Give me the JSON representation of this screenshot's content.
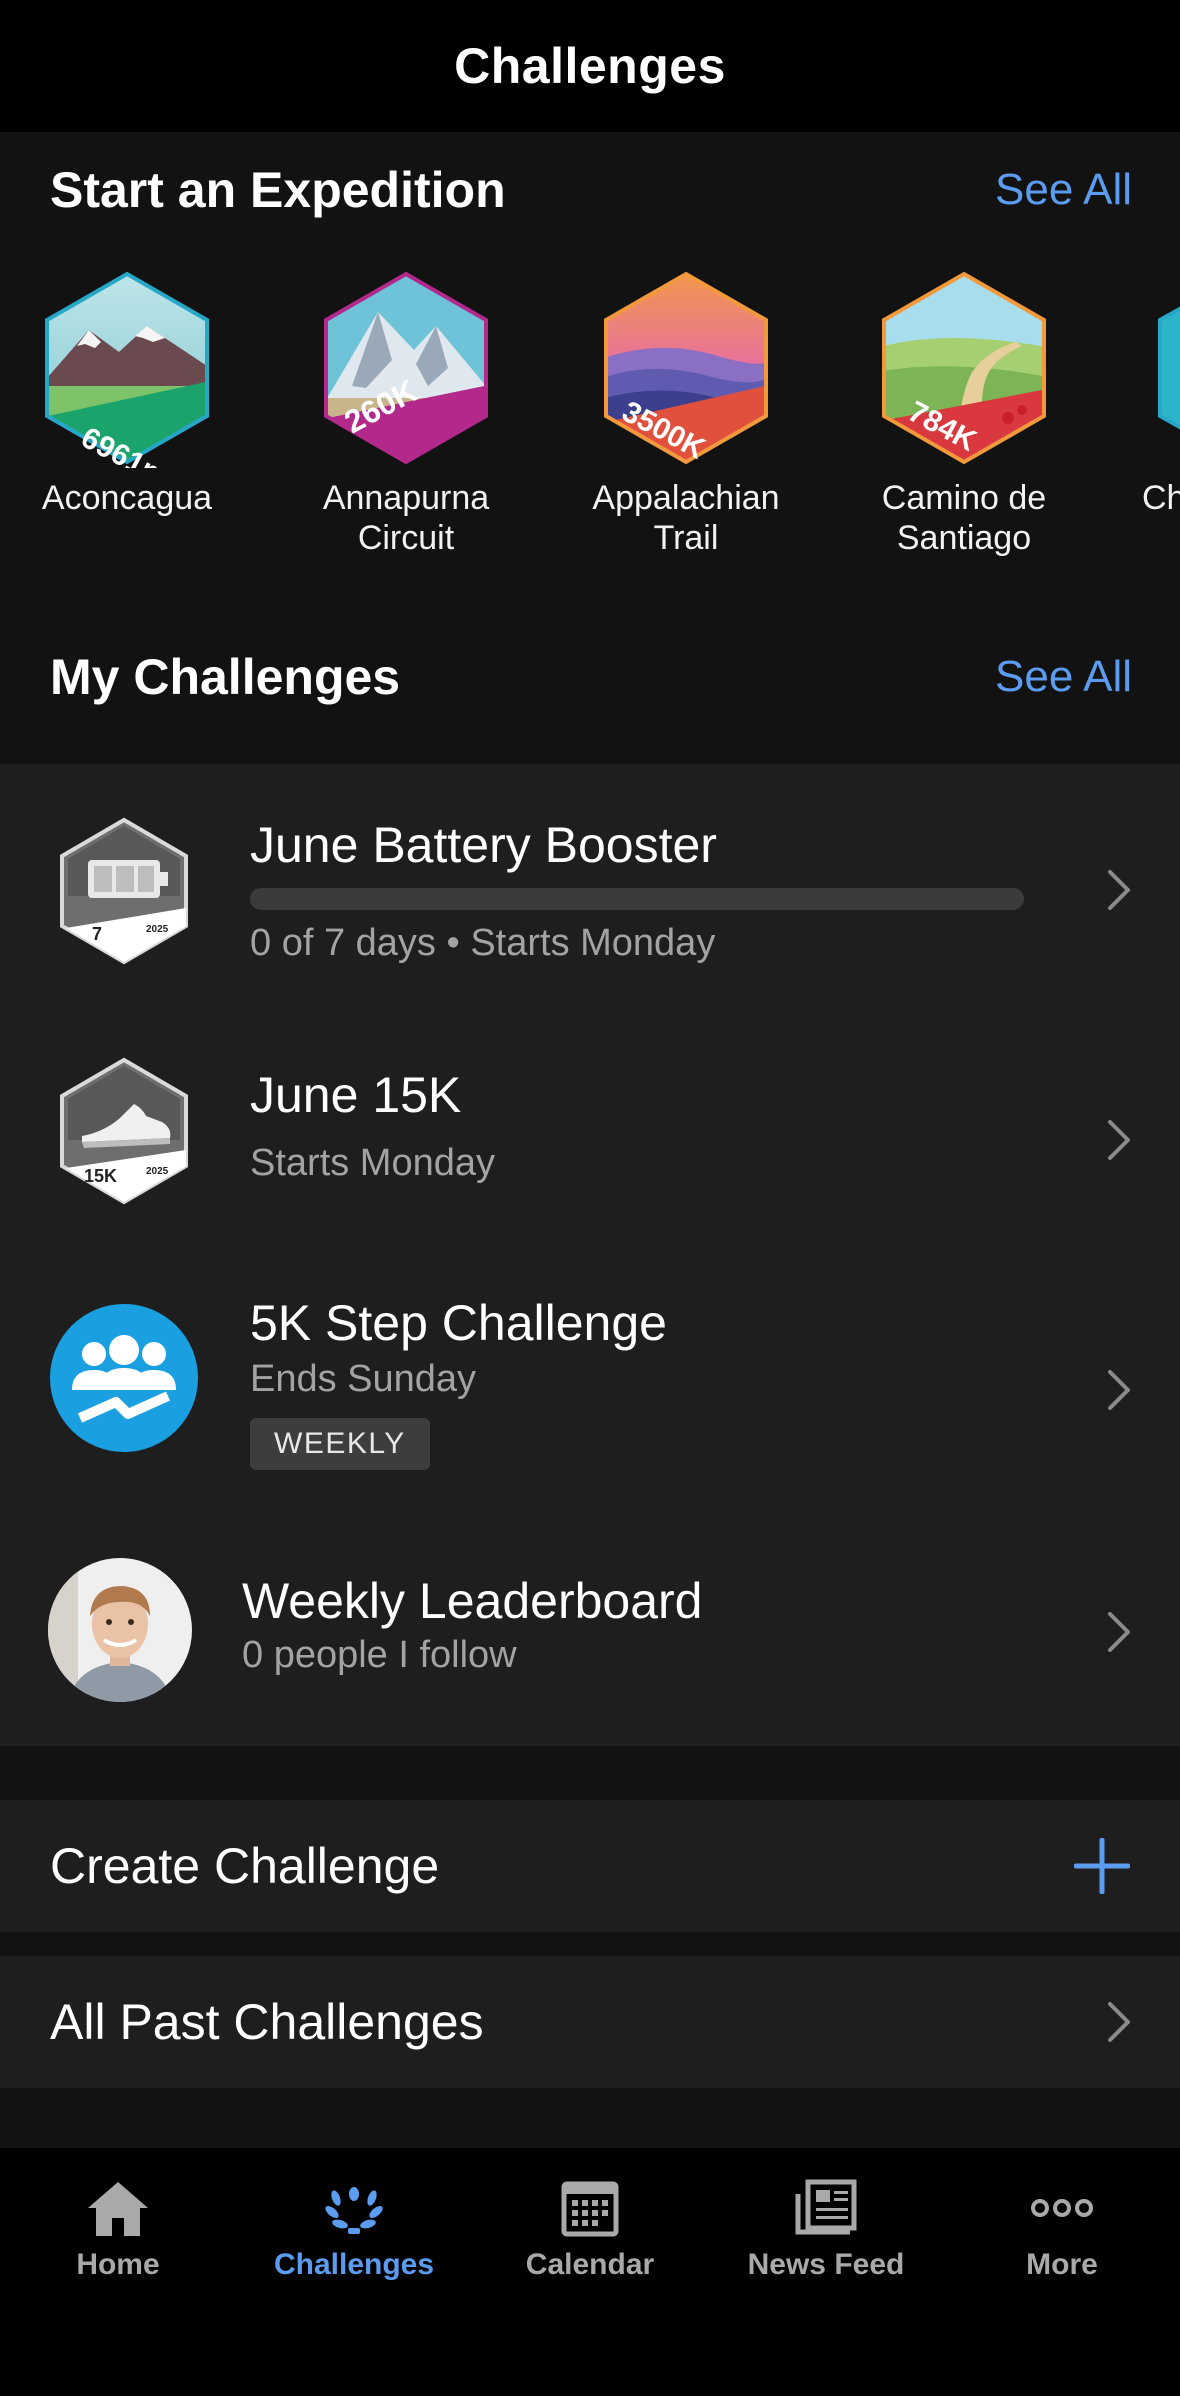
{
  "header": {
    "title": "Challenges"
  },
  "expedition": {
    "title": "Start an Expedition",
    "see_all": "See All",
    "badges": [
      {
        "badge_text": "6961m",
        "name": "Aconcagua",
        "icon": "mountain-badge-icon",
        "accent": "#1aa36b",
        "frame": "#27a7c7"
      },
      {
        "badge_text": "260K",
        "name": "Annapurna Circuit",
        "icon": "snowy-peak-badge-icon",
        "accent": "#b3298b",
        "frame": "#b3298b"
      },
      {
        "badge_text": "3500K",
        "name": "Appalachian Trail",
        "icon": "sunset-hills-badge-icon",
        "accent": "#e0503c",
        "frame": "#f29a3b"
      },
      {
        "badge_text": "784K",
        "name": "Camino de Santiago",
        "icon": "trail-badge-icon",
        "accent": "#d8383e",
        "frame": "#f29a3b"
      },
      {
        "badge_text": "",
        "name": "Ch",
        "icon": "partial-badge-icon",
        "accent": "#27a7c7",
        "frame": "#27a7c7"
      }
    ]
  },
  "my_challenges": {
    "title": "My Challenges",
    "see_all": "See All",
    "items": [
      {
        "title": "June Battery Booster",
        "subtitle": "0 of 7 days • Starts Monday",
        "badge_num": "7",
        "badge_year": "2025",
        "progress": 0
      },
      {
        "title": "June 15K",
        "subtitle": "Starts Monday",
        "badge_num": "15K",
        "badge_year": "2025"
      },
      {
        "title": "5K Step Challenge",
        "subtitle": "Ends Sunday",
        "tag": "WEEKLY"
      },
      {
        "title": "Weekly Leaderboard",
        "subtitle": "0 people I follow"
      }
    ]
  },
  "actions": {
    "create": "Create Challenge",
    "past": "All Past Challenges"
  },
  "tabbar": {
    "items": [
      {
        "label": "Home",
        "icon": "home-icon"
      },
      {
        "label": "Challenges",
        "icon": "laurel-icon",
        "active": true
      },
      {
        "label": "Calendar",
        "icon": "calendar-icon"
      },
      {
        "label": "News Feed",
        "icon": "newspaper-icon"
      },
      {
        "label": "More",
        "icon": "more-dots-icon"
      }
    ]
  },
  "colors": {
    "accent": "#5b9cf0",
    "background": "#000000",
    "surface": "#1e1e1e",
    "section": "#121212"
  }
}
